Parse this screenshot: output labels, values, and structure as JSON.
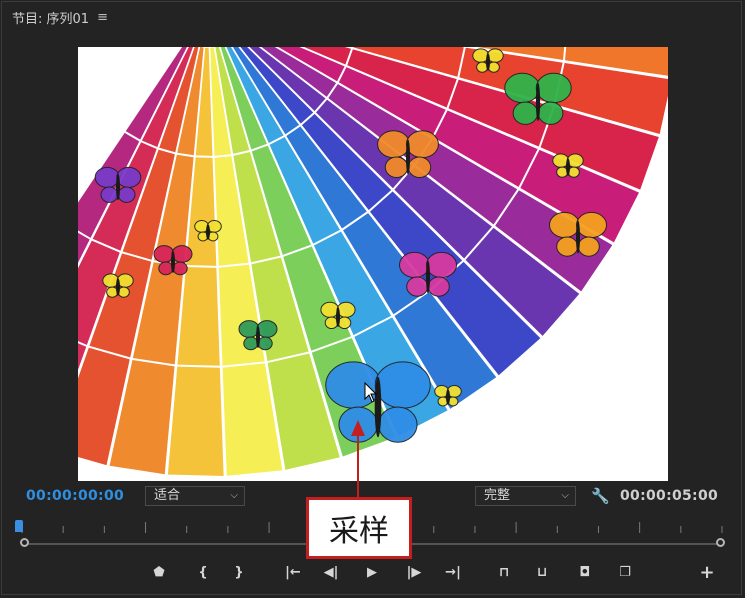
{
  "panel": {
    "title": "节目: 序列01",
    "menu_icon": "≡"
  },
  "viewer": {
    "content": "color-fan-butterflies-image"
  },
  "timecode": {
    "current": "00:00:00:00",
    "duration": "00:00:05:00"
  },
  "zoom_select": {
    "value": "适合"
  },
  "quality_select": {
    "value": "完整"
  },
  "transport": {
    "buttons": [
      {
        "name": "add-marker-button",
        "icon": "marker-icon",
        "glyph": "⬟"
      },
      {
        "name": "mark-in-button",
        "icon": "mark-in-icon",
        "glyph": "{"
      },
      {
        "name": "mark-out-button",
        "icon": "mark-out-icon",
        "glyph": "}"
      },
      {
        "name": "go-to-in-button",
        "icon": "go-to-in-icon",
        "glyph": "|←"
      },
      {
        "name": "step-back-button",
        "icon": "step-back-icon",
        "glyph": "◀|"
      },
      {
        "name": "play-button",
        "icon": "play-icon",
        "glyph": "▶"
      },
      {
        "name": "step-forward-button",
        "icon": "step-forward-icon",
        "glyph": "|▶"
      },
      {
        "name": "go-to-out-button",
        "icon": "go-to-out-icon",
        "glyph": "→|"
      },
      {
        "name": "lift-button",
        "icon": "lift-icon",
        "glyph": "⊓"
      },
      {
        "name": "extract-button",
        "icon": "extract-icon",
        "glyph": "⊔"
      },
      {
        "name": "export-frame-button",
        "icon": "camera-icon",
        "glyph": "◘"
      },
      {
        "name": "compare-view-button",
        "icon": "compare-icon",
        "glyph": "❐"
      },
      {
        "name": "button-editor-button",
        "icon": "plus-icon",
        "glyph": "+"
      }
    ]
  },
  "callout": {
    "label": "采样",
    "color": "#c41f1f"
  }
}
